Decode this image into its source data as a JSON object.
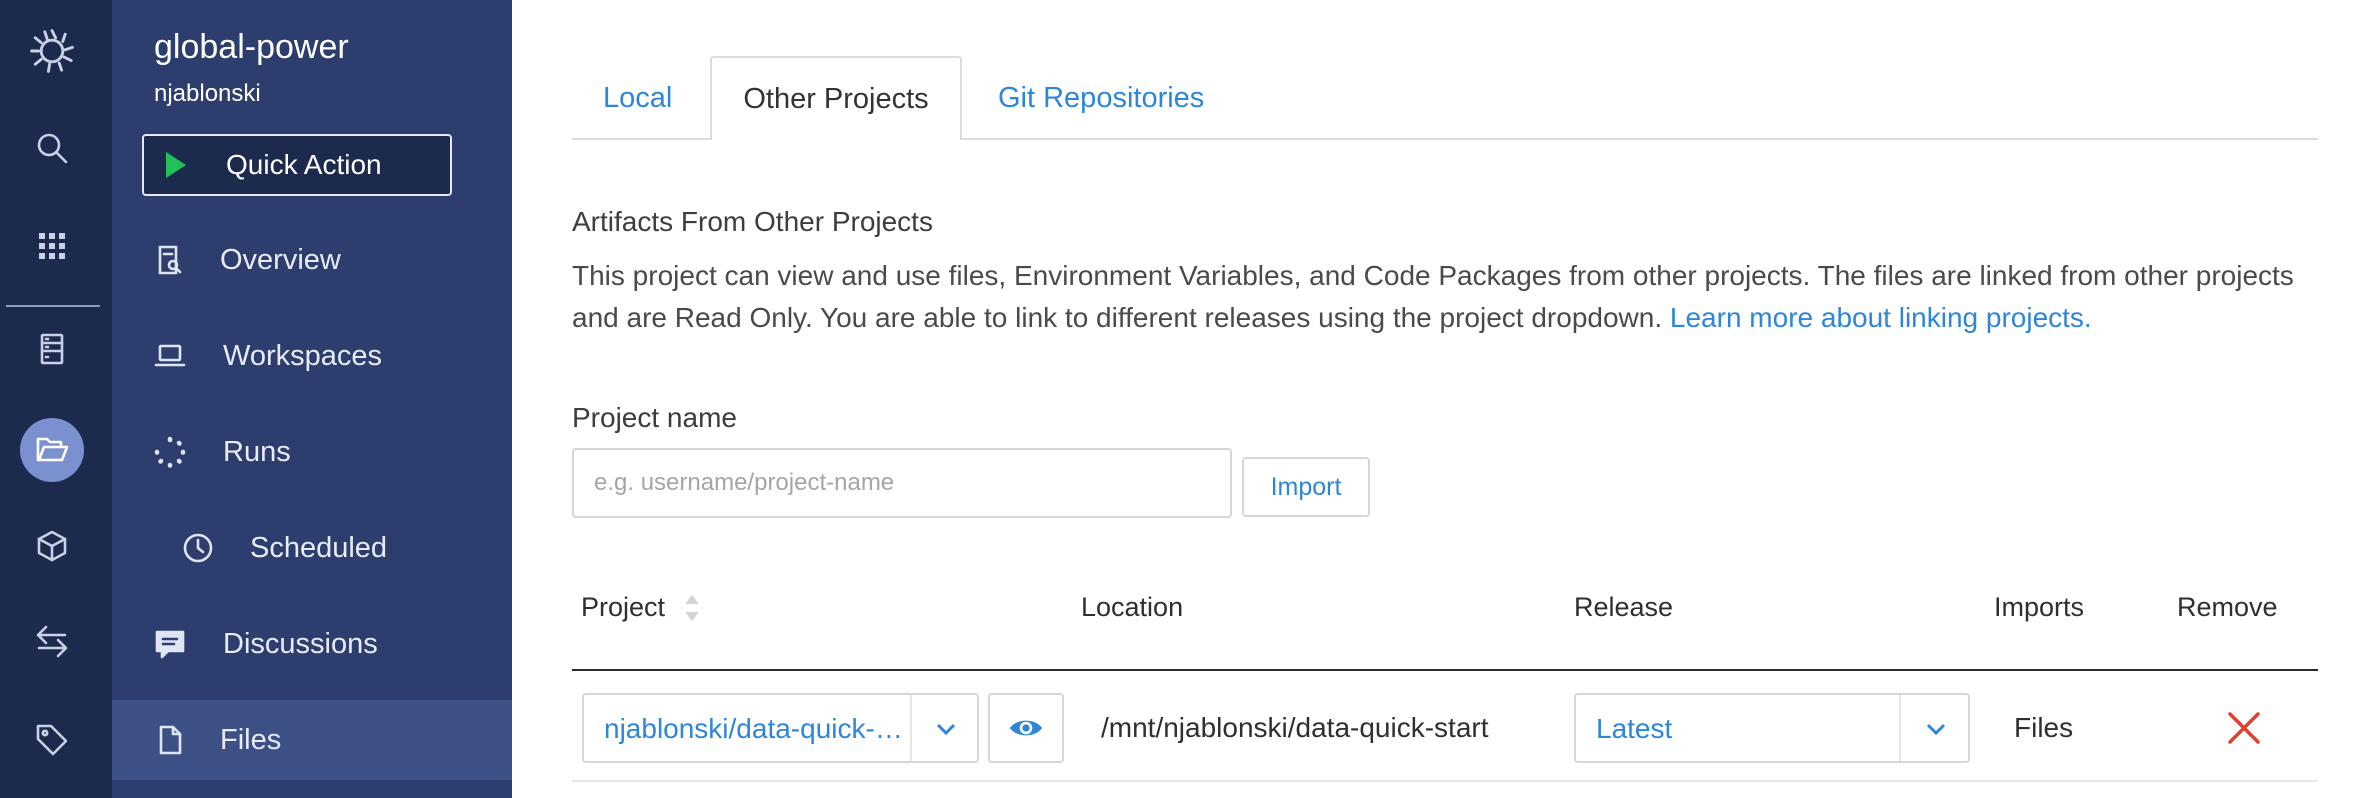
{
  "project": {
    "name": "global-power",
    "owner": "njablonski"
  },
  "quick_action": {
    "label": "Quick Action"
  },
  "rail": {
    "icons": [
      "logo-icon",
      "search-icon",
      "grid-icon",
      "projects-icon",
      "folder-icon",
      "cube-icon",
      "transfer-icon",
      "tag-icon"
    ],
    "active": "folder-icon"
  },
  "nav": {
    "items": [
      {
        "label": "Overview",
        "icon": "overview-icon"
      },
      {
        "label": "Workspaces",
        "icon": "laptop-icon"
      },
      {
        "label": "Runs",
        "icon": "spinner-icon"
      },
      {
        "label": "Scheduled",
        "icon": "clock-icon"
      },
      {
        "label": "Discussions",
        "icon": "chat-icon"
      },
      {
        "label": "Files",
        "icon": "file-icon",
        "active": true
      }
    ]
  },
  "tabs": [
    {
      "label": "Local"
    },
    {
      "label": "Other Projects",
      "active": true
    },
    {
      "label": "Git Repositories"
    }
  ],
  "section": {
    "title": "Artifacts From Other Projects",
    "description": "This project can view and use files, Environment Variables, and Code Packages from other projects. The files are linked from other projects and are Read Only. You are able to link to different releases using the project dropdown.",
    "learn_more": "Learn more about linking projects."
  },
  "import_form": {
    "label": "Project name",
    "placeholder": "e.g. username/project-name",
    "button": "Import"
  },
  "table": {
    "headers": [
      "Project",
      "Location",
      "Release",
      "Imports",
      "Remove"
    ],
    "rows": [
      {
        "project": "njablonski/data-quick-start",
        "location": "/mnt/njablonski/data-quick-start",
        "release": "Latest",
        "imports": "Files"
      }
    ]
  },
  "colors": {
    "rail_bg": "#1c2a4e",
    "sidebar_bg": "#2d3e6e",
    "link": "#2d86d9",
    "play": "#23c05a",
    "remove": "#e0412f"
  }
}
